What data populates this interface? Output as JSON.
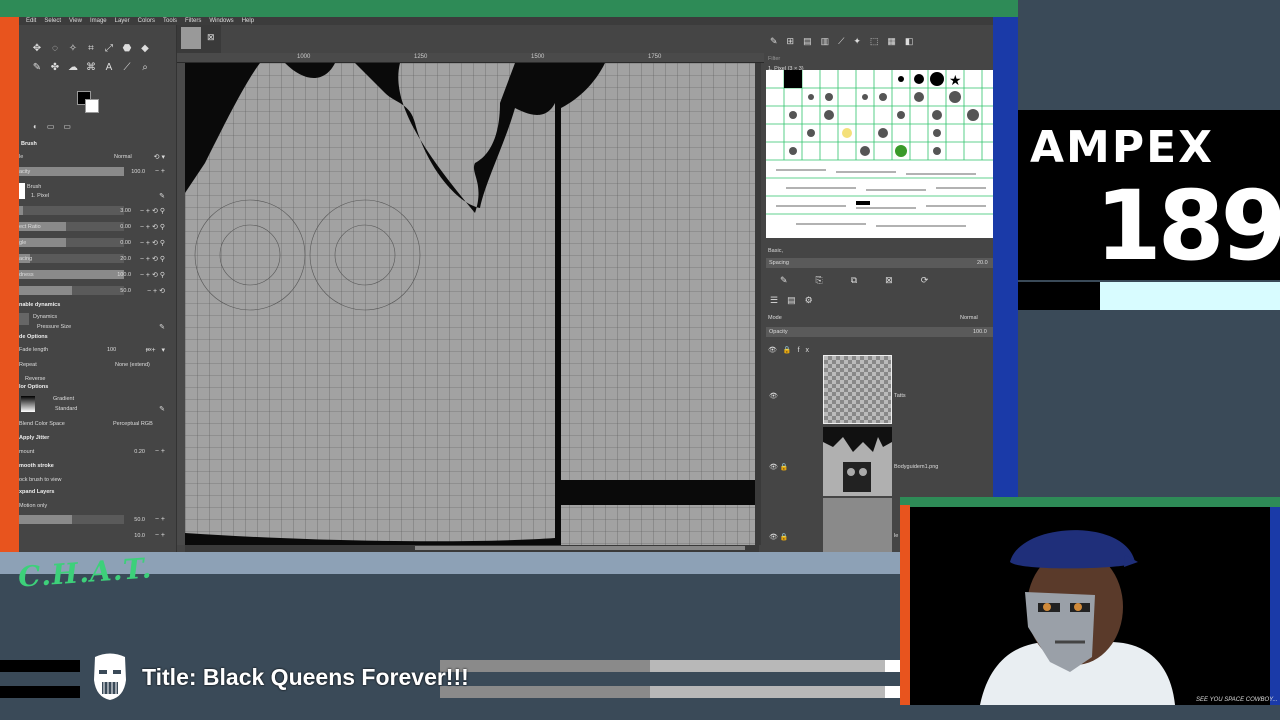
{
  "stream": {
    "brand": "AMPEX",
    "episode": "189",
    "chat_label": "C.H.A.T.",
    "title": "Title: Black Queens Forever!!!",
    "cam_caption": "SEE YOU SPACE COWBOY..."
  },
  "gimp": {
    "menu": [
      "Edit",
      "Select",
      "View",
      "Image",
      "Layer",
      "Colors",
      "Tools",
      "Filters",
      "Windows",
      "Help"
    ],
    "rulers": [
      "1000",
      "1250",
      "1500",
      "1750"
    ],
    "tool_options": {
      "header": "Brush",
      "mode_label": "le",
      "mode_value": "Normal",
      "opacity_label": "acity",
      "opacity_value": "100.0",
      "brush_label": "Brush",
      "brush_name": "1. Pixel",
      "size_value": "3.00",
      "aspect_label": "ect Ratio",
      "aspect_value": "0.00",
      "angle_label": "gle",
      "angle_value": "0.00",
      "spacing_label": "acing",
      "spacing_value": "20.0",
      "hardness_label": "dness",
      "hardness_value": "100.0",
      "force_value": "50.0",
      "dynamics_section": "nable dynamics",
      "dynamics_label": "Dynamics",
      "dynamics_value": "Pressure Size",
      "fade_section": "de Options",
      "fade_label": "Fade length",
      "fade_value": "100",
      "fade_unit": "px",
      "repeat_label": "Repeat",
      "repeat_value": "None (extend)",
      "reverse_label": "Reverse",
      "color_section": "lor Options",
      "gradient_label": "Gradient",
      "gradient_value": "Standard",
      "blend_label": "Blend Color Space",
      "blend_value": "Perceptual RGB",
      "jitter_section": "Apply Jitter",
      "amount_label": "mount",
      "amount_value": "0.20",
      "smooth_section": "mooth stroke",
      "lock_label": "ock brush to view",
      "expand_section": "xpand Layers",
      "motion_label": "Motion only",
      "val_a": "50.0",
      "val_b": "10.0"
    },
    "brushes": {
      "filter_placeholder": "Filter",
      "current": "1. Pixel (3 × 3)",
      "tag": "Basic,",
      "spacing_label": "Spacing",
      "spacing_value": "20.0"
    },
    "layers": {
      "mode_label": "Mode",
      "mode_value": "Normal",
      "opacity_label": "Opacity",
      "opacity_value": "100.0",
      "items": [
        "Tatts",
        "Bodyguidem1.png",
        "le"
      ]
    }
  }
}
